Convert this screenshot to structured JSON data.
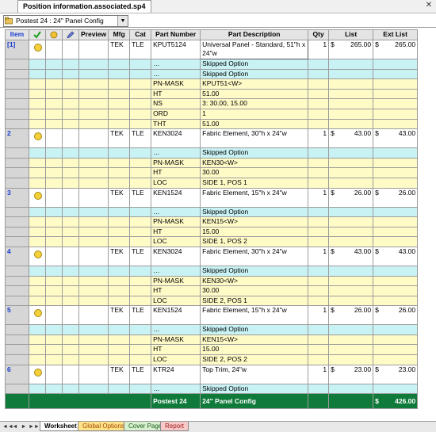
{
  "window": {
    "doc_tab": "Position information.associated.sp4",
    "close_symbol": "✕"
  },
  "config_select": {
    "value": "Postest 24 : 24\" Panel Config",
    "arrow": "▼"
  },
  "headers": [
    "Item",
    "",
    "",
    "",
    "Preview",
    "Mfg",
    "Cat",
    "Part Number",
    "Part Description",
    "Qty",
    "List",
    "Ext List"
  ],
  "rows": [
    {
      "type": "white",
      "item": "[1]",
      "smile": true,
      "mfg": "TEK",
      "cat": "TLE",
      "pn": "KPUT5124",
      "desc": "Universal Panel - Standard, 51\"h x 24\"w",
      "qty": "1",
      "cur": "$",
      "list": "265.00",
      "cur2": "$",
      "ext": "265.00",
      "tall": true,
      "boxed": true
    },
    {
      "type": "cyan",
      "pn": "…",
      "desc": "Skipped Option"
    },
    {
      "type": "cyan",
      "pn": "…",
      "desc": "Skipped Option"
    },
    {
      "type": "yellow",
      "pn": "PN-MASK",
      "desc": "KPUT51<W>"
    },
    {
      "type": "yellow",
      "pn": "HT",
      "desc": "51.00"
    },
    {
      "type": "yellow",
      "pn": "NS",
      "desc": "3: 30.00, 15.00"
    },
    {
      "type": "yellow",
      "pn": "ORD",
      "desc": "1"
    },
    {
      "type": "yellow",
      "pn": "THT",
      "desc": "51.00"
    },
    {
      "type": "white",
      "item": "2",
      "smile": true,
      "mfg": "TEK",
      "cat": "TLE",
      "pn": "KEN3024",
      "desc": "Fabric Element, 30\"h x 24\"w",
      "qty": "1",
      "cur": "$",
      "list": "43.00",
      "cur2": "$",
      "ext": "43.00",
      "tall": true
    },
    {
      "type": "cyan",
      "pn": "…",
      "desc": "Skipped Option"
    },
    {
      "type": "yellow",
      "pn": "PN-MASK",
      "desc": "KEN30<W>"
    },
    {
      "type": "yellow",
      "pn": "HT",
      "desc": "30.00"
    },
    {
      "type": "yellow",
      "pn": "LOC",
      "desc": "SIDE 1, POS 1"
    },
    {
      "type": "white",
      "item": "3",
      "smile": true,
      "mfg": "TEK",
      "cat": "TLE",
      "pn": "KEN1524",
      "desc": "Fabric Element, 15\"h x 24\"w",
      "qty": "1",
      "cur": "$",
      "list": "26.00",
      "cur2": "$",
      "ext": "26.00",
      "tall": true
    },
    {
      "type": "cyan",
      "pn": "…",
      "desc": "Skipped Option"
    },
    {
      "type": "yellow",
      "pn": "PN-MASK",
      "desc": "KEN15<W>"
    },
    {
      "type": "yellow",
      "pn": "HT",
      "desc": "15.00"
    },
    {
      "type": "yellow",
      "pn": "LOC",
      "desc": "SIDE 1, POS 2"
    },
    {
      "type": "white",
      "item": "4",
      "smile": true,
      "mfg": "TEK",
      "cat": "TLE",
      "pn": "KEN3024",
      "desc": "Fabric Element, 30\"h x 24\"w",
      "qty": "1",
      "cur": "$",
      "list": "43.00",
      "cur2": "$",
      "ext": "43.00",
      "tall": true
    },
    {
      "type": "cyan",
      "pn": "…",
      "desc": "Skipped Option"
    },
    {
      "type": "yellow",
      "pn": "PN-MASK",
      "desc": "KEN30<W>"
    },
    {
      "type": "yellow",
      "pn": "HT",
      "desc": "30.00"
    },
    {
      "type": "yellow",
      "pn": "LOC",
      "desc": "SIDE 2, POS 1"
    },
    {
      "type": "white",
      "item": "5",
      "smile": true,
      "mfg": "TEK",
      "cat": "TLE",
      "pn": "KEN1524",
      "desc": "Fabric Element, 15\"h x 24\"w",
      "qty": "1",
      "cur": "$",
      "list": "26.00",
      "cur2": "$",
      "ext": "26.00",
      "tall": true
    },
    {
      "type": "cyan",
      "pn": "…",
      "desc": "Skipped Option"
    },
    {
      "type": "yellow",
      "pn": "PN-MASK",
      "desc": "KEN15<W>"
    },
    {
      "type": "yellow",
      "pn": "HT",
      "desc": "15.00"
    },
    {
      "type": "yellow",
      "pn": "LOC",
      "desc": "SIDE 2, POS 2"
    },
    {
      "type": "white",
      "item": "6",
      "smile": true,
      "mfg": "TEK",
      "cat": "TLE",
      "pn": "KTR24",
      "desc": "Top Trim, 24\"w",
      "qty": "1",
      "cur": "$",
      "list": "23.00",
      "cur2": "$",
      "ext": "23.00",
      "tall": true
    },
    {
      "type": "cyan",
      "pn": "…",
      "desc": "Skipped Option"
    }
  ],
  "total": {
    "name": "Postest 24",
    "desc": "24\" Panel Config",
    "cur": "$",
    "ext": "426.00"
  },
  "sheet_tabs": [
    {
      "label": "Worksheet",
      "color": "#ffffff",
      "text": "#000000"
    },
    {
      "label": "Global Options",
      "color": "#ffe28a",
      "text": "#a14a00"
    },
    {
      "label": "Cover Page",
      "color": "#d8f0d0",
      "text": "#1a5c1a"
    },
    {
      "label": "Report",
      "color": "#f7c9c9",
      "text": "#a11a1a"
    }
  ],
  "nav_arrows": [
    "◄◄",
    "◄",
    "►",
    "►►"
  ],
  "colors": {
    "accent_blue": "#1a3ccf",
    "total_green": "#0f7a3a"
  }
}
